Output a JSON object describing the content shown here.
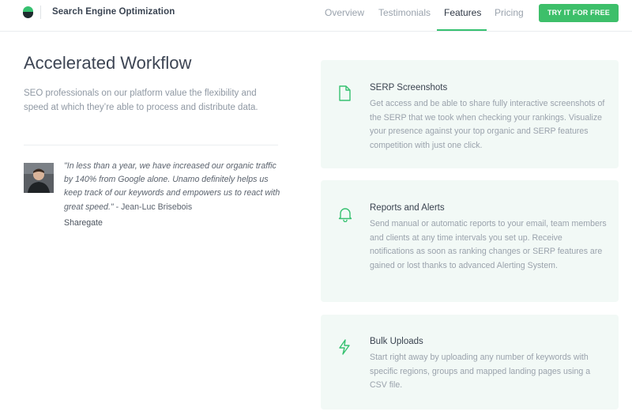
{
  "header": {
    "brand": "Search Engine Optimization",
    "nav": [
      {
        "label": "Overview",
        "active": false
      },
      {
        "label": "Testimonials",
        "active": false
      },
      {
        "label": "Features",
        "active": true
      },
      {
        "label": "Pricing",
        "active": false
      }
    ],
    "cta_label": "TRY IT FOR FREE"
  },
  "hero": {
    "title": "Accelerated Workflow",
    "description": "SEO professionals on our platform value the flexibility and speed at which they’re able to process and distribute data."
  },
  "testimonial": {
    "quote": "\"In less than a year, we have increased our organic traffic by 140% from Google alone. Unamo definitely helps us keep track of our keywords and empowers us to react with great speed.\"",
    "author": " - Jean-Luc Brisebois",
    "company": "Sharegate"
  },
  "features": [
    {
      "icon": "file-icon",
      "title": "SERP Screenshots",
      "text": "Get access and be able to share fully interactive screenshots of the SERP that we took when checking your rankings. Visualize your presence against your top organic and SERP features competition with just one click."
    },
    {
      "icon": "bell-icon",
      "title": "Reports and Alerts",
      "text": "Send manual or automatic reports to your email, team members and clients at any time intervals you set up. Receive notifications as soon as ranking changes or SERP features are gained or lost thanks to advanced Alerting System."
    },
    {
      "icon": "lightning-icon",
      "title": "Bulk Uploads",
      "text": "Start right away by uploading any number of keywords with specific regions, groups and mapped landing pages using a CSV file."
    }
  ],
  "colors": {
    "accent": "#36c170",
    "card_background": "#f2f9f6"
  }
}
